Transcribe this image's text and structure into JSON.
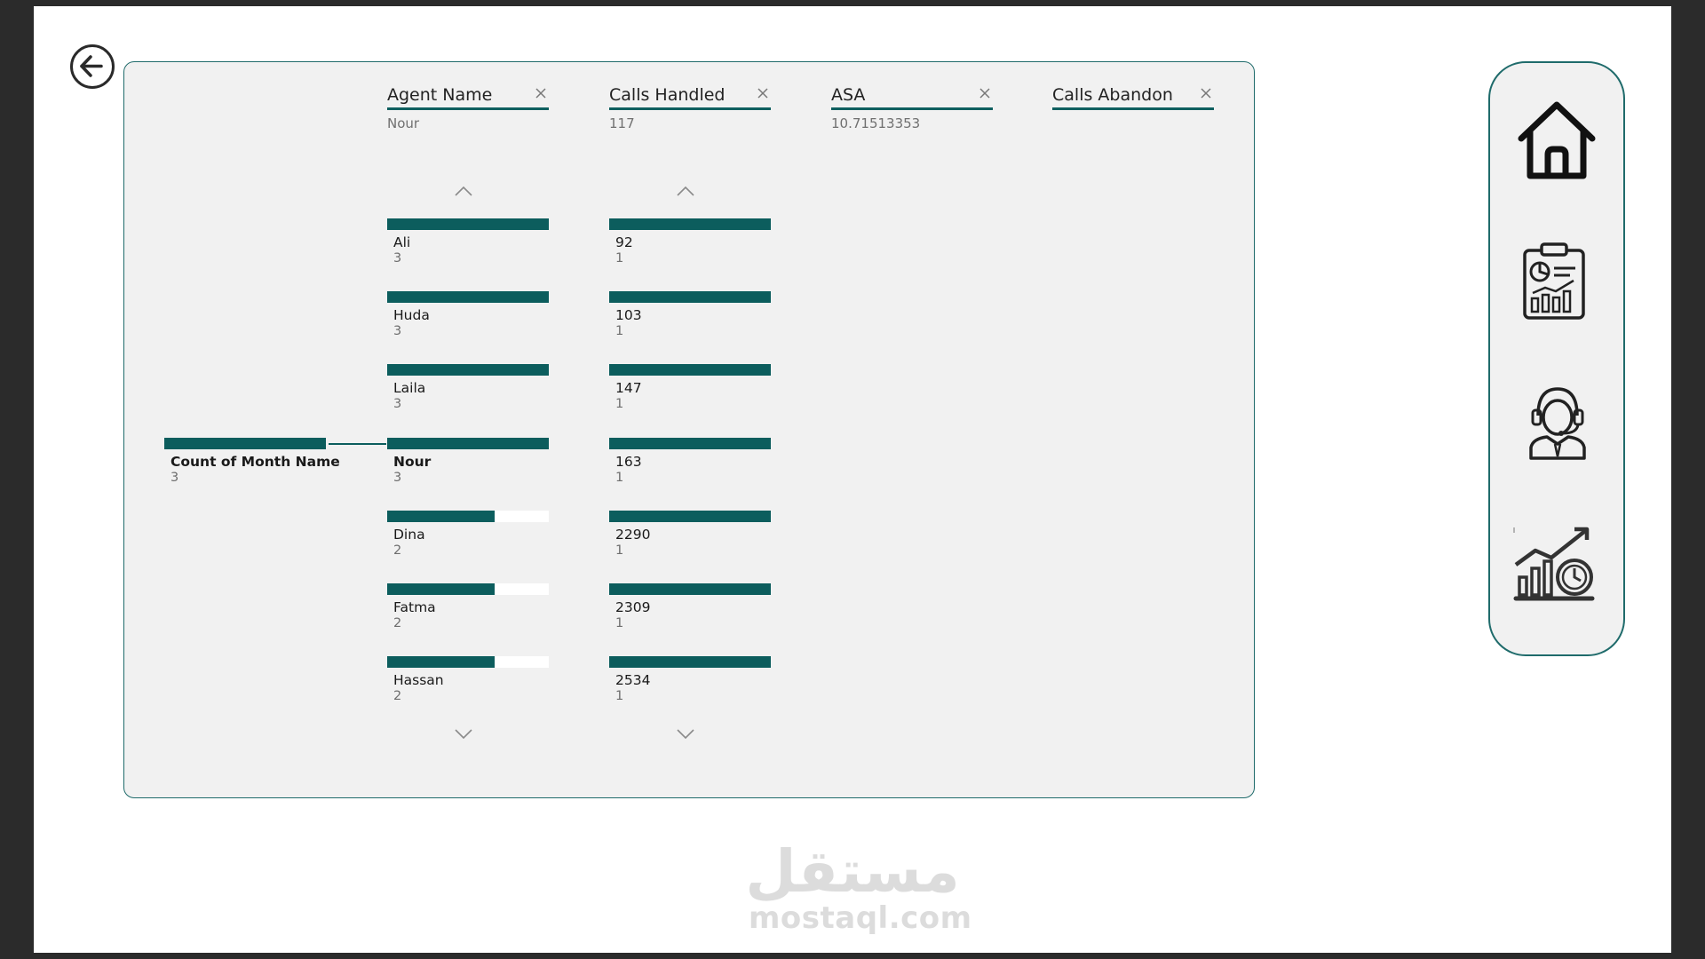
{
  "columns": [
    {
      "title": "Agent Name",
      "selected": "Nour"
    },
    {
      "title": "Calls Handled",
      "selected": "117"
    },
    {
      "title": "ASA",
      "selected": "10.71513353"
    },
    {
      "title": "Calls Abandon",
      "selected": ""
    }
  ],
  "root": {
    "label": "Count of Month Name",
    "count": "3"
  },
  "agent_nodes": [
    {
      "label": "Ali",
      "count": "3",
      "fill": 1.0
    },
    {
      "label": "Huda",
      "count": "3",
      "fill": 1.0
    },
    {
      "label": "Laila",
      "count": "3",
      "fill": 1.0
    },
    {
      "label": "Nour",
      "count": "3",
      "fill": 1.0
    },
    {
      "label": "Dina",
      "count": "2",
      "fill": 0.667
    },
    {
      "label": "Fatma",
      "count": "2",
      "fill": 0.667
    },
    {
      "label": "Hassan",
      "count": "2",
      "fill": 0.667
    }
  ],
  "calls_nodes": [
    {
      "label": "92",
      "count": "1",
      "fill": 1.0
    },
    {
      "label": "103",
      "count": "1",
      "fill": 1.0
    },
    {
      "label": "147",
      "count": "1",
      "fill": 1.0
    },
    {
      "label": "163",
      "count": "1",
      "fill": 1.0
    },
    {
      "label": "2290",
      "count": "1",
      "fill": 1.0
    },
    {
      "label": "2309",
      "count": "1",
      "fill": 1.0
    },
    {
      "label": "2534",
      "count": "1",
      "fill": 1.0
    }
  ],
  "nav": {
    "icons": [
      "home-icon",
      "report-clipboard-icon",
      "call-agent-icon",
      "growth-chart-clock-icon"
    ]
  },
  "watermark": {
    "arabic": "مستقل",
    "latin": "mostaql.com"
  },
  "colors": {
    "accent": "#0c5d5d",
    "panel": "#f1f1f1",
    "border": "#1f6b6b"
  }
}
